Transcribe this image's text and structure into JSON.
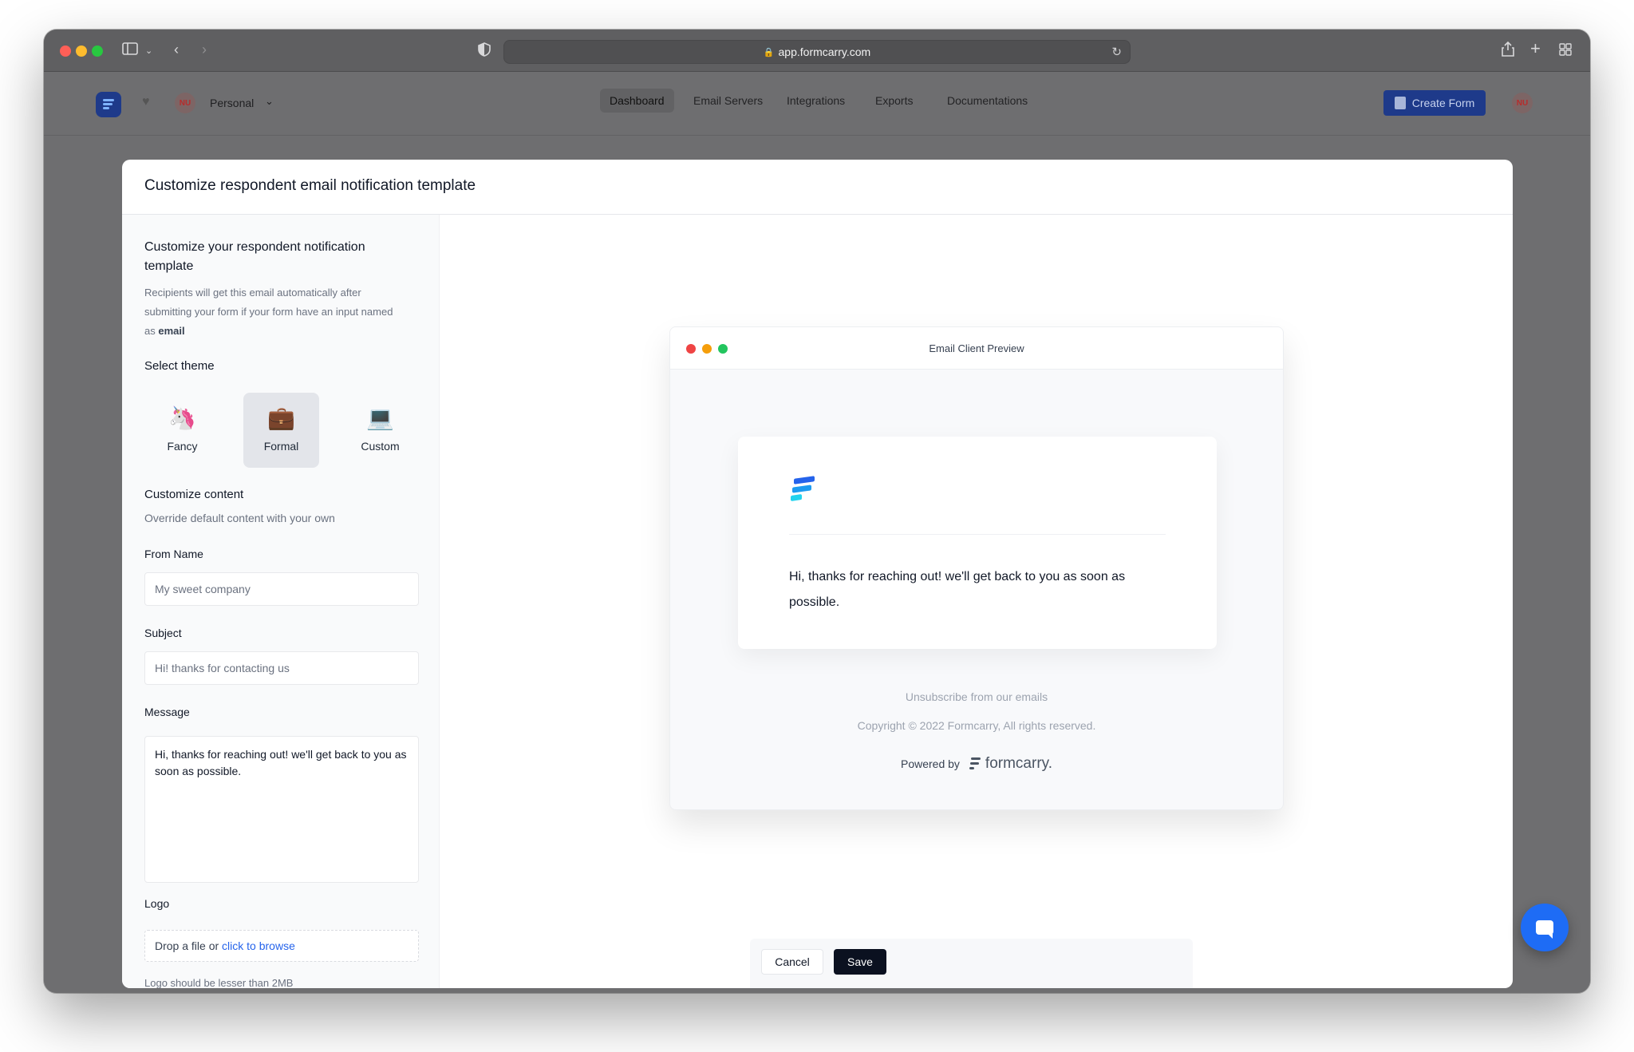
{
  "browser": {
    "url": "app.formcarry.com"
  },
  "app_nav": {
    "workspace_avatar": "NU",
    "workspace_name": "Personal",
    "links": [
      {
        "label": "Dashboard",
        "active": true
      },
      {
        "label": "Email Servers",
        "active": false
      },
      {
        "label": "Integrations",
        "active": false
      },
      {
        "label": "Exports",
        "active": false
      },
      {
        "label": "Documentations",
        "active": false
      }
    ],
    "create_button": "Create Form",
    "user_avatar": "NU"
  },
  "modal": {
    "title": "Customize respondent email notification template",
    "left": {
      "heading": "Customize your respondent notification template",
      "description_prefix": "Recipients will get this email automatically after submitting your form if your form have an input named as ",
      "description_bold": "email",
      "theme_label": "Select theme",
      "themes": [
        {
          "name": "Fancy",
          "icon": "unicorn-icon",
          "glyph": "🦄",
          "selected": false
        },
        {
          "name": "Formal",
          "icon": "briefcase-icon",
          "glyph": "💼",
          "selected": true
        },
        {
          "name": "Custom",
          "icon": "laptop-icon",
          "glyph": "💻",
          "selected": false
        }
      ],
      "content_label": "Customize content",
      "content_desc": "Override default content with your own",
      "from_name_label": "From Name",
      "from_name_placeholder": "My sweet company",
      "subject_label": "Subject",
      "subject_placeholder": "Hi! thanks for contacting us",
      "message_label": "Message",
      "message_value": "Hi, thanks for reaching out! we'll get back to you as soon as possible.",
      "logo_label": "Logo",
      "dropzone_text": "Drop a file or ",
      "dropzone_link": "click to browse",
      "logo_hint": "Logo should be lesser than 2MB"
    },
    "preview": {
      "title": "Email Client Preview",
      "message": "Hi, thanks for reaching out! we'll get back to you as soon as possible.",
      "unsubscribe": "Unsubscribe from our emails",
      "copyright": "Copyright © 2022 Formcarry, All rights reserved.",
      "powered_by": "Powered by",
      "brand": "formcarry."
    },
    "footer": {
      "cancel": "Cancel",
      "save": "Save"
    }
  },
  "colors": {
    "accent": "#1e3a8a",
    "save_button": "#0b1120",
    "link": "#2563eb",
    "chat": "#1e6cf5"
  }
}
